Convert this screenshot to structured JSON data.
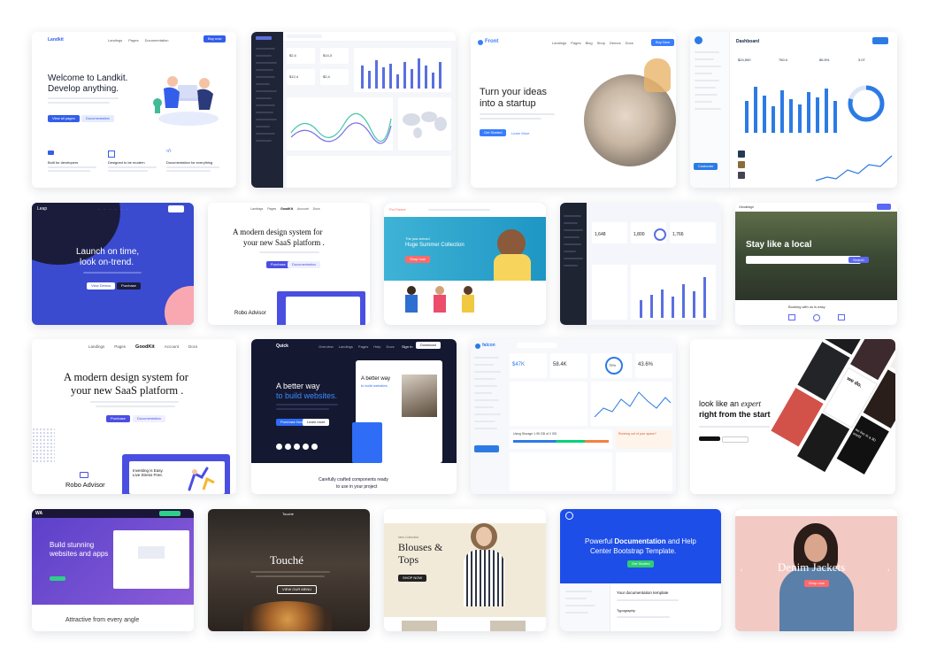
{
  "landkit": {
    "logo": "Landkit",
    "nav": [
      "Landings",
      "Pages",
      "Documentation"
    ],
    "buy_label": "Buy now",
    "headline_1": "Welcome to Landkit.",
    "headline_2": "Develop anything.",
    "view_pages": "View all pages",
    "documentation": "Documentation",
    "features": [
      "Built for developers",
      "Designed to be modern",
      "Documentation for everything"
    ]
  },
  "admin_dashboard": {
    "stats": [
      "$2,4",
      "$14,3",
      "$12,4",
      "$2,4"
    ]
  },
  "front": {
    "logo": "Front",
    "nav": [
      "Landings",
      "Pages",
      "Blog",
      "Shop",
      "Demos",
      "Docs"
    ],
    "buy_label": "Buy Now",
    "headline_1": "Turn your ideas",
    "headline_2": "into a startup",
    "get_started": "Get Started",
    "learn_more": "Learn More"
  },
  "dashboard_kit": {
    "title": "Dashboard",
    "stats": [
      "$24,500",
      "760.0",
      "86.5%",
      "3.07"
    ],
    "cta": "Customer"
  },
  "leap": {
    "logo": "Leap",
    "headline_1": "Launch on time,",
    "headline_2": "look on-trend.",
    "view_demos": "View Demos",
    "purchase": "Purchase"
  },
  "goodkit_small": {
    "logo": "GoodKit",
    "headline_1": "A modern design system for",
    "headline_2": "your new SaaS platform .",
    "purchase": "Purchase",
    "documentation": "Documentation",
    "robo_advisor": "Robo Advisor"
  },
  "shop_theme": {
    "logo": "ProTheme",
    "eyebrow": "The just arrived",
    "headline": "Huge Summer Collection",
    "cta": "Shop now"
  },
  "dark_admin": {
    "stats": [
      "1,648",
      "1,800",
      "1,766"
    ]
  },
  "travel": {
    "logo": "Geodesign",
    "headline": "Stay like a local",
    "search": "Search",
    "tagline": "Booking with us is easy"
  },
  "goodkit_large": {
    "nav": [
      "Landings",
      "Pages",
      "GoodKit",
      "Account",
      "Docs"
    ],
    "headline_1": "A modern design system for",
    "headline_2": "your new SaaS platform .",
    "purchase": "Purchase",
    "documentation": "Documentation",
    "robo_advisor": "Robo Advisor",
    "phone_title": "Investing is Easy. Live Stress Free."
  },
  "quick": {
    "logo": "Quick",
    "nav": [
      "Overview",
      "Landings",
      "Pages",
      "Help",
      "Docs"
    ],
    "sign_in": "Sign In",
    "download": "Download",
    "headline_1": "A better way",
    "headline_2": "to build websites.",
    "purchase": "Purchase Now",
    "learn_more": "Learn more",
    "caption_1": "Carefully crafted components ready",
    "caption_2": "to use in your project",
    "phone_text_1": "A better way",
    "phone_text_2": "to build websites."
  },
  "falcon": {
    "logo": "falcon",
    "stats": [
      "$47K",
      "58.4K",
      "43.6%"
    ],
    "dial": "75%",
    "alert": "Running out of your space?",
    "usage": "Using Storage 1.95 GB of 2 GB"
  },
  "agency": {
    "headline_1a": "look like an ",
    "headline_1b": "expert",
    "headline_2": "right from the start",
    "tile_1": "we do.",
    "tile_2": "we live in a 3D world"
  },
  "wa": {
    "headline_1": "Build stunning",
    "headline_2": "websites and apps",
    "tagline": "Attractive from every angle"
  },
  "touche": {
    "logo": "Touché",
    "headline": "Touché",
    "cta": "VIEW OUR MENU"
  },
  "fashion": {
    "eyebrow": "New Collection",
    "headline_1": "Blouses &",
    "headline_2": "Tops",
    "cta": "SHOP NOW"
  },
  "docs": {
    "headline_1a": "Powerful ",
    "headline_1b": "Documentation",
    "headline_1c": " and Help",
    "headline_2": "Center Bootstrap Template.",
    "cta": "Get Started",
    "doc_title": "Your documentation template",
    "doc_subtitle": "Typography"
  },
  "denim": {
    "headline": "Denim Jackets",
    "cta": "Shop now"
  },
  "colors": {
    "primary_blue": "#335eea",
    "indigo": "#4a4fe2",
    "leap_blue": "#3a4bcf",
    "dark_navy": "#1b1c3b",
    "docs_blue": "#1d4ee8",
    "falcon_blue": "#2c7be5"
  }
}
